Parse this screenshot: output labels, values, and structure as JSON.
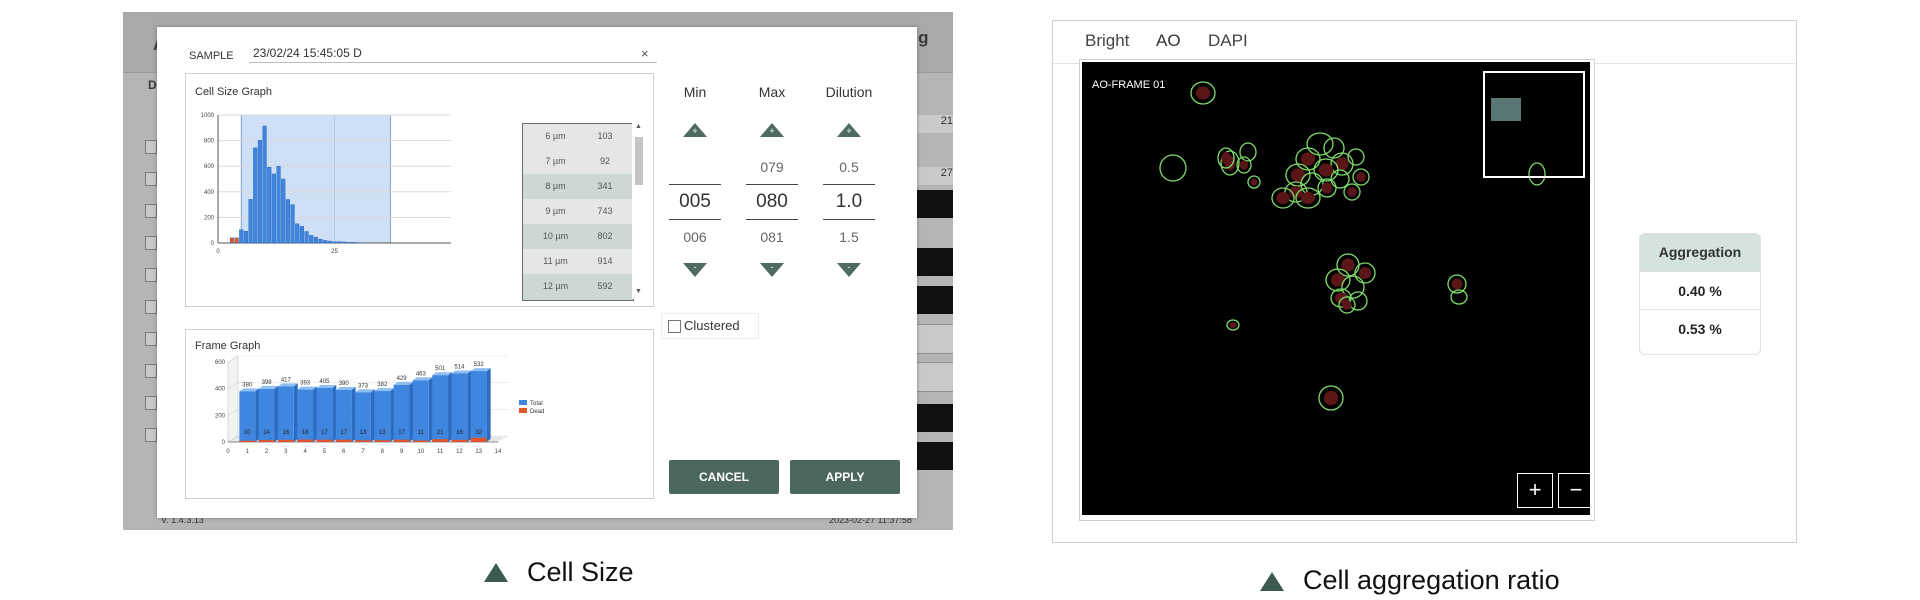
{
  "app": {
    "bg_letter_a": "A",
    "bg_title_suffix": "ing",
    "bg_letter_d": "D",
    "bg_num_1": "21",
    "bg_num_2": "27",
    "version": "V. 1.4.3.13",
    "timestamp": "2023-02-27 11:37:58"
  },
  "dialog": {
    "sample_label": "SAMPLE",
    "sample_value": "23/02/24 15:45:05 D",
    "clear_icon": "×",
    "cell_size_title": "Cell Size Graph",
    "frame_graph_title": "Frame Graph",
    "size_table": [
      {
        "size": "6 µm",
        "count": "103"
      },
      {
        "size": "7 µm",
        "count": "92"
      },
      {
        "size": "8 µm",
        "count": "341"
      },
      {
        "size": "9 µm",
        "count": "743"
      },
      {
        "size": "10 µm",
        "count": "802"
      },
      {
        "size": "11 µm",
        "count": "914"
      },
      {
        "size": "12 µm",
        "count": "592"
      }
    ],
    "scroll_up": "▲",
    "scroll_down": "▼",
    "min": {
      "label": "Min",
      "above": "",
      "value": "005",
      "below": "006"
    },
    "max": {
      "label": "Max",
      "above": "079",
      "value": "080",
      "below": "081"
    },
    "dilution": {
      "label": "Dilution",
      "above": "0.5",
      "value": "1.0",
      "below": "1.5"
    },
    "plus_sign": "+",
    "minus_sign": "-",
    "clustered_label": "Clustered",
    "cancel_label": "CANCEL",
    "apply_label": "APPLY",
    "colors": {
      "accent": "#4c6760",
      "total": "#3e86e0",
      "dead": "#e0562a"
    }
  },
  "chart_data": [
    {
      "type": "bar",
      "title": "Cell Size Graph",
      "ylim": [
        0,
        1000
      ],
      "xlim": [
        0,
        50
      ],
      "yticks": [
        0,
        200,
        400,
        600,
        800,
        1000
      ],
      "xticks": [
        0,
        25
      ],
      "selected_range": [
        5,
        37
      ],
      "grid": true,
      "series": [
        {
          "color": "#e0562a",
          "x": [
            3,
            4
          ],
          "values": [
            40,
            40
          ]
        },
        {
          "color": "#3e86e0",
          "x": [
            5,
            6,
            7,
            8,
            9,
            10,
            11,
            12,
            13,
            14,
            15,
            16,
            17,
            18,
            19,
            20,
            21,
            22,
            23,
            24,
            25,
            26,
            27,
            28,
            29,
            30,
            31
          ],
          "values": [
            103,
            92,
            341,
            743,
            802,
            914,
            592,
            540,
            600,
            500,
            340,
            300,
            150,
            130,
            90,
            60,
            45,
            30,
            20,
            15,
            10,
            10,
            8,
            5,
            5,
            3,
            2
          ]
        }
      ]
    },
    {
      "type": "bar",
      "title": "Frame Graph",
      "categories": [
        "1",
        "2",
        "3",
        "4",
        "5",
        "6",
        "7",
        "8",
        "9",
        "10",
        "11",
        "12",
        "13"
      ],
      "ylim": [
        0,
        600
      ],
      "yticks": [
        0,
        200,
        400,
        600
      ],
      "xticks": [
        "0",
        "1",
        "2",
        "3",
        "4",
        "5",
        "6",
        "7",
        "8",
        "9",
        "10",
        "11",
        "12",
        "13",
        "14"
      ],
      "legend_position": "right",
      "series": [
        {
          "name": "Total",
          "color": "#3e86e0",
          "values": [
            380,
            398,
            417,
            393,
            405,
            390,
            373,
            382,
            429,
            463,
            501,
            514,
            532
          ]
        },
        {
          "name": "Dead",
          "color": "#e0562a",
          "values": [
            10,
            14,
            16,
            18,
            17,
            17,
            13,
            13,
            17,
            11,
            21,
            16,
            32
          ]
        }
      ]
    }
  ],
  "captions": {
    "left": "Cell Size",
    "right": "Cell aggregation ratio"
  },
  "viewer": {
    "tabs": [
      "Bright",
      "AO",
      "DAPI"
    ],
    "active_tab": "AO",
    "frame_label": "AO-FRAME 01",
    "zoom_in": "+",
    "zoom_out": "−"
  },
  "aggregation": {
    "header": "Aggregation",
    "values": [
      "0.40 %",
      "0.53 %"
    ]
  }
}
